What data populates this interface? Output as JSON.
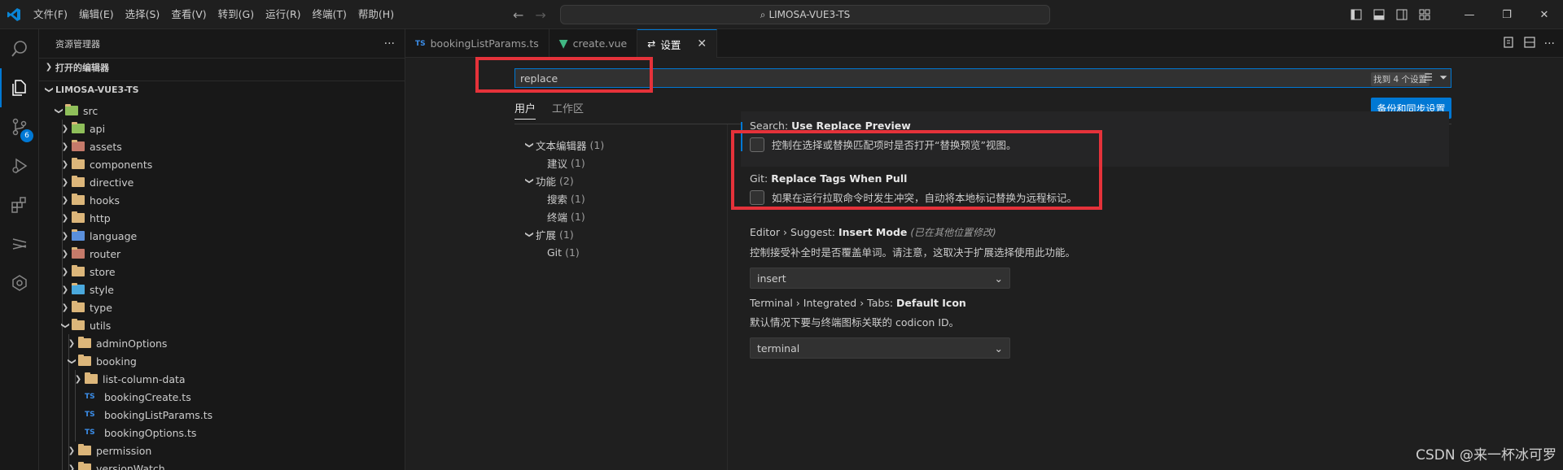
{
  "menu": [
    "文件(F)",
    "编辑(E)",
    "选择(S)",
    "查看(V)",
    "转到(G)",
    "运行(R)",
    "终端(T)",
    "帮助(H)"
  ],
  "command_center": "LIMOSA-VUE3-TS",
  "activity": {
    "scm_badge": "6"
  },
  "sidebar": {
    "title": "资源管理器",
    "more": "···",
    "open_editors": "打开的编辑器",
    "project": "LIMOSA-VUE3-TS"
  },
  "tree": [
    {
      "label": "src",
      "depth": 1,
      "open": true,
      "kind": "folder",
      "color": "#8fbf5a"
    },
    {
      "label": "api",
      "depth": 2,
      "open": false,
      "kind": "folder",
      "color": "#8fbf5a"
    },
    {
      "label": "assets",
      "depth": 2,
      "open": false,
      "kind": "folder",
      "color": "#c57a6a"
    },
    {
      "label": "components",
      "depth": 2,
      "open": false,
      "kind": "folder",
      "color": "#dcb67a"
    },
    {
      "label": "directive",
      "depth": 2,
      "open": false,
      "kind": "folder",
      "color": "#dcb67a"
    },
    {
      "label": "hooks",
      "depth": 2,
      "open": false,
      "kind": "folder",
      "color": "#dcb67a"
    },
    {
      "label": "http",
      "depth": 2,
      "open": false,
      "kind": "folder",
      "color": "#dcb67a"
    },
    {
      "label": "language",
      "depth": 2,
      "open": false,
      "kind": "folder",
      "color": "#5a8fdc"
    },
    {
      "label": "router",
      "depth": 2,
      "open": false,
      "kind": "folder",
      "color": "#c57a6a"
    },
    {
      "label": "store",
      "depth": 2,
      "open": false,
      "kind": "folder",
      "color": "#dcb67a"
    },
    {
      "label": "style",
      "depth": 2,
      "open": false,
      "kind": "folder",
      "color": "#4aa8dc"
    },
    {
      "label": "type",
      "depth": 2,
      "open": false,
      "kind": "folder",
      "color": "#dcb67a"
    },
    {
      "label": "utils",
      "depth": 2,
      "open": true,
      "kind": "folder",
      "color": "#dcb67a"
    },
    {
      "label": "adminOptions",
      "depth": 3,
      "open": false,
      "kind": "folder",
      "color": "#dcb67a"
    },
    {
      "label": "booking",
      "depth": 3,
      "open": true,
      "kind": "folder",
      "color": "#dcb67a"
    },
    {
      "label": "list-column-data",
      "depth": 4,
      "open": false,
      "kind": "folder",
      "color": "#dcb67a"
    },
    {
      "label": "bookingCreate.ts",
      "depth": 4,
      "open": null,
      "kind": "ts",
      "color": "#3b8eea"
    },
    {
      "label": "bookingListParams.ts",
      "depth": 4,
      "open": null,
      "kind": "ts",
      "color": "#3b8eea"
    },
    {
      "label": "bookingOptions.ts",
      "depth": 4,
      "open": null,
      "kind": "ts",
      "color": "#3b8eea"
    },
    {
      "label": "permission",
      "depth": 3,
      "open": false,
      "kind": "folder",
      "color": "#dcb67a"
    },
    {
      "label": "versionWatch",
      "depth": 3,
      "open": false,
      "kind": "folder",
      "color": "#dcb67a"
    }
  ],
  "tabs": [
    {
      "label": "bookingListParams.ts",
      "icon": "TS"
    },
    {
      "label": "create.vue",
      "icon": "V"
    },
    {
      "label": "设置",
      "icon": "⇄"
    }
  ],
  "settings": {
    "search_value": "replace",
    "search_count": "找到 4 个设置",
    "scope_user": "用户",
    "scope_workspace": "工作区",
    "sync_button": "备份和同步设置",
    "toc": [
      {
        "label": "文本编辑器",
        "count": "(1)",
        "group": true
      },
      {
        "label": "建议",
        "count": "(1)",
        "group": false
      },
      {
        "label": "功能",
        "count": "(2)",
        "group": true
      },
      {
        "label": "搜索",
        "count": "(1)",
        "group": false
      },
      {
        "label": "终端",
        "count": "(1)",
        "group": false
      },
      {
        "label": "扩展",
        "count": "(1)",
        "group": true
      },
      {
        "label": "Git",
        "count": "(1)",
        "group": false
      }
    ],
    "items": [
      {
        "prefix": "Search: ",
        "name": "Use Replace Preview",
        "modified": "",
        "desc": "控制在选择或替换匹配项时是否打开“替换预览”视图。",
        "checkbox": true,
        "checked": false
      },
      {
        "prefix": "Git: ",
        "name": "Replace Tags When Pull",
        "modified": "",
        "desc": "如果在运行拉取命令时发生冲突，自动将本地标记替换为远程标记。",
        "checkbox": true,
        "checked": false
      },
      {
        "prefix": "Editor › Suggest: ",
        "name": "Insert Mode",
        "modified": "(已在其他位置修改)",
        "desc": "控制接受补全时是否覆盖单词。请注意，这取决于扩展选择使用此功能。",
        "checkbox": false,
        "select": "insert"
      },
      {
        "prefix": "Terminal › Integrated › Tabs: ",
        "name": "Default Icon",
        "modified": "",
        "desc": "默认情况下要与终端图标关联的 codicon ID。",
        "checkbox": false,
        "select": "terminal"
      }
    ]
  },
  "watermark": "CSDN @来一杯冰可罗",
  "colors": {
    "accent": "#0078d4",
    "highlight": "#e5323a"
  }
}
